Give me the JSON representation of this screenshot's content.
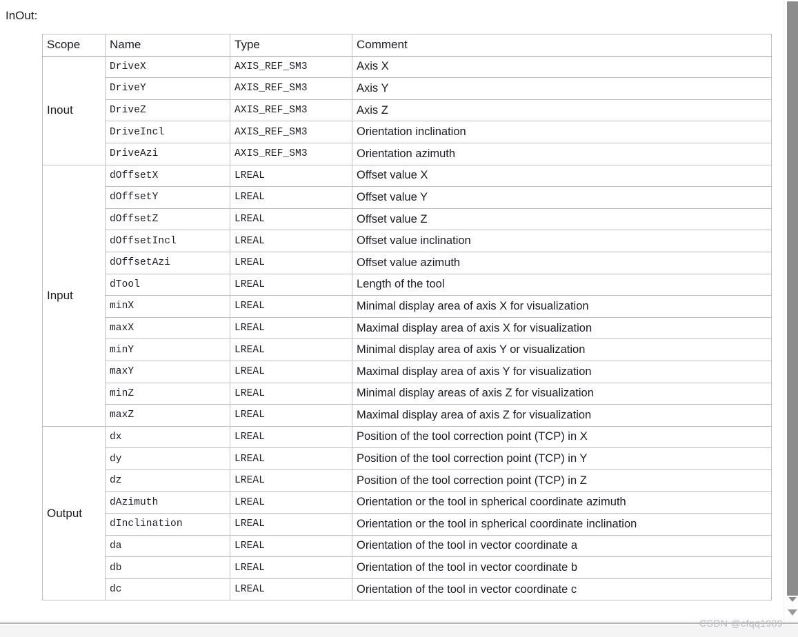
{
  "caption": "InOut:",
  "colors": {
    "page_background": "#ffffff",
    "table_border": "#bfbfbf",
    "table_outer_border": "#a8a8a8",
    "text": "#1b1b24",
    "scrollbar_thumb": "#8c8c8c",
    "watermark_text": "#b9b9c2",
    "bottom_rule": "#b4b4b4"
  },
  "table": {
    "headers": [
      "Scope",
      "Name",
      "Type",
      "Comment"
    ],
    "groups": [
      {
        "scope": "Inout",
        "rows": [
          {
            "name": "DriveX",
            "type": "AXIS_REF_SM3",
            "comment": "Axis X"
          },
          {
            "name": "DriveY",
            "type": "AXIS_REF_SM3",
            "comment": "Axis Y"
          },
          {
            "name": "DriveZ",
            "type": "AXIS_REF_SM3",
            "comment": "Axis Z"
          },
          {
            "name": "DriveIncl",
            "type": "AXIS_REF_SM3",
            "comment": "Orientation inclination"
          },
          {
            "name": "DriveAzi",
            "type": "AXIS_REF_SM3",
            "comment": "Orientation azimuth"
          }
        ]
      },
      {
        "scope": "Input",
        "rows": [
          {
            "name": "dOffsetX",
            "type": "LREAL",
            "comment": "Offset value X"
          },
          {
            "name": "dOffsetY",
            "type": "LREAL",
            "comment": "Offset value Y"
          },
          {
            "name": "dOffsetZ",
            "type": "LREAL",
            "comment": "Offset value Z"
          },
          {
            "name": "dOffsetIncl",
            "type": "LREAL",
            "comment": "Offset value inclination"
          },
          {
            "name": "dOffsetAzi",
            "type": "LREAL",
            "comment": "Offset value azimuth"
          },
          {
            "name": "dTool",
            "type": "LREAL",
            "comment": "Length of the tool"
          },
          {
            "name": "minX",
            "type": "LREAL",
            "comment": "Minimal display area of axis X for visualization"
          },
          {
            "name": "maxX",
            "type": "LREAL",
            "comment": "Maximal display area of axis X for visualization"
          },
          {
            "name": "minY",
            "type": "LREAL",
            "comment": "Minimal display area of axis Y or visualization"
          },
          {
            "name": "maxY",
            "type": "LREAL",
            "comment": "Maximal display area of axis Y for visualization"
          },
          {
            "name": "minZ",
            "type": "LREAL",
            "comment": "Minimal display areas of axis Z for visualization"
          },
          {
            "name": "maxZ",
            "type": "LREAL",
            "comment": "Maximal display area of axis Z for visualization"
          }
        ]
      },
      {
        "scope": "Output",
        "rows": [
          {
            "name": "dx",
            "type": "LREAL",
            "comment": "Position of the tool correction point (TCP) in X"
          },
          {
            "name": "dy",
            "type": "LREAL",
            "comment": "Position of the tool correction point (TCP) in Y"
          },
          {
            "name": "dz",
            "type": "LREAL",
            "comment": "Position of the tool correction point (TCP) in Z"
          },
          {
            "name": "dAzimuth",
            "type": "LREAL",
            "comment": "Orientation or the tool in spherical coordinate azimuth"
          },
          {
            "name": "dInclination",
            "type": "LREAL",
            "comment": "Orientation or the tool in spherical coordinate inclination"
          },
          {
            "name": "da",
            "type": "LREAL",
            "comment": "Orientation of the tool in vector coordinate a"
          },
          {
            "name": "db",
            "type": "LREAL",
            "comment": "Orientation of the tool in vector coordinate b"
          },
          {
            "name": "dc",
            "type": "LREAL",
            "comment": "Orientation of the tool in vector coordinate c"
          }
        ]
      }
    ]
  },
  "scrollbar": {
    "orientation": "vertical",
    "up_arrow_icon": "caret-up-icon",
    "down_arrow_icon": "caret-down-icon",
    "thumb_icon": "scroll-thumb"
  },
  "watermark": "CSDN @cfqq1989"
}
